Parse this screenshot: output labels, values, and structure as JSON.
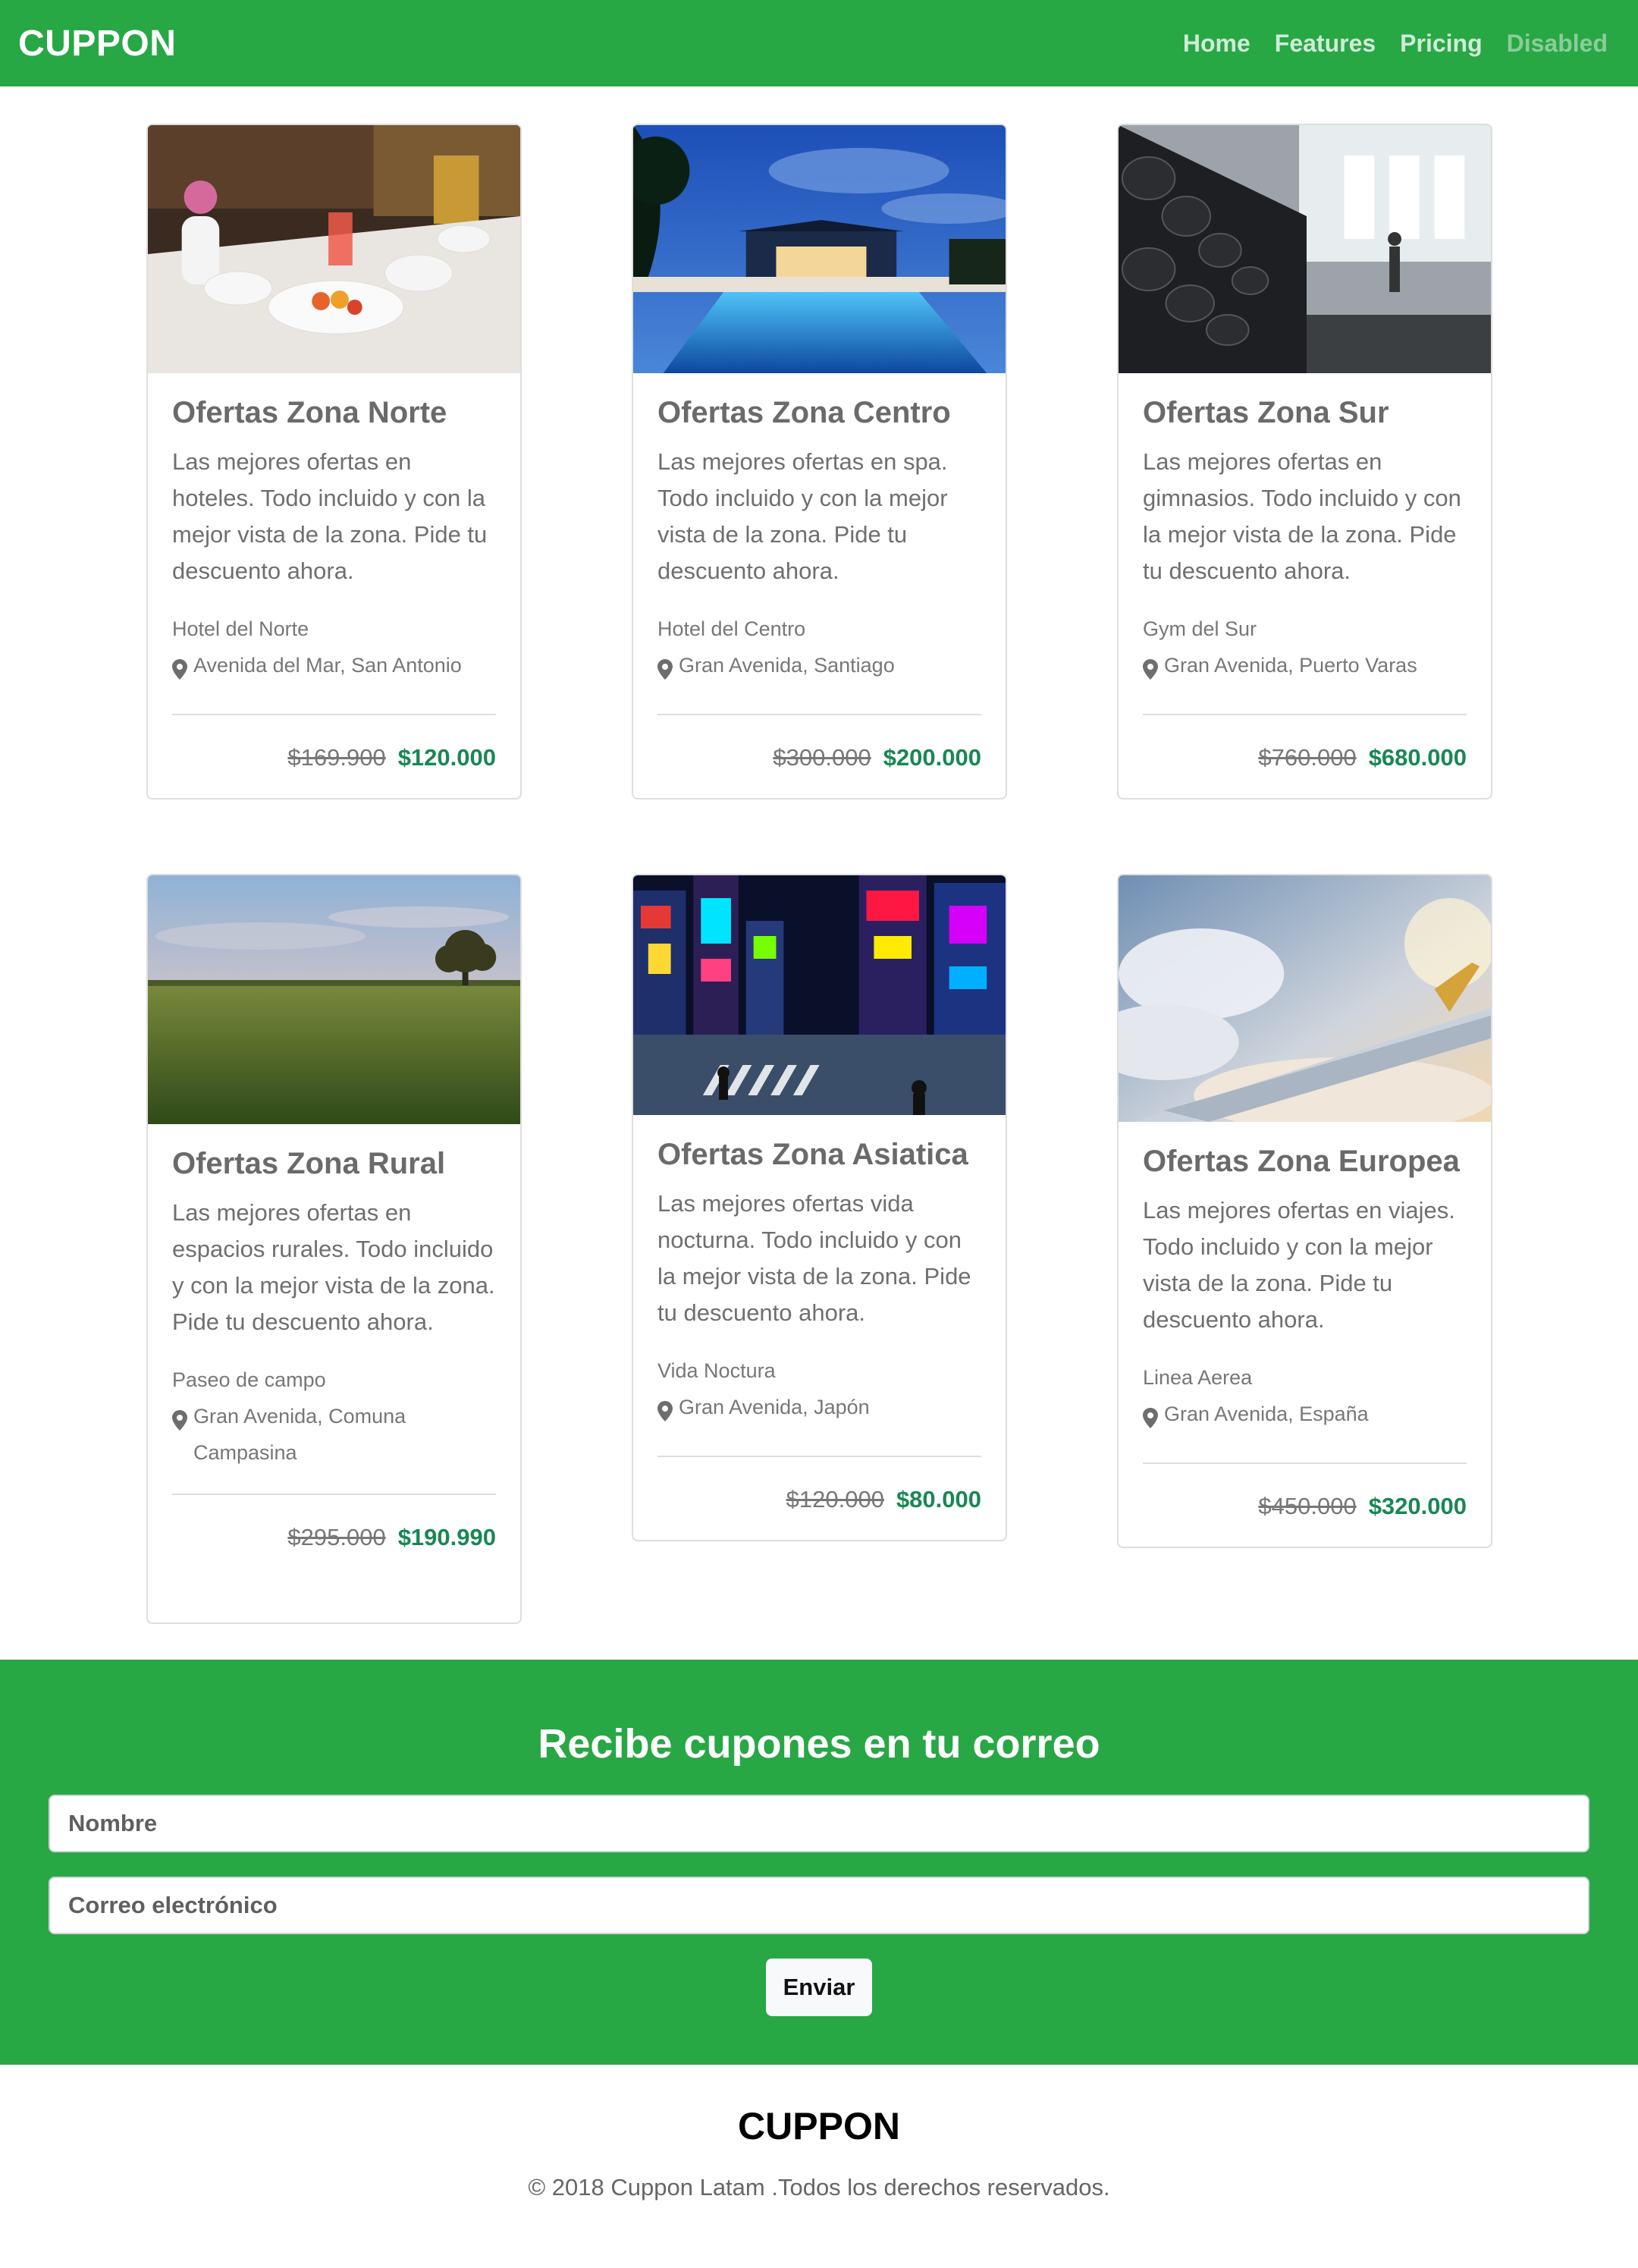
{
  "navbar": {
    "brand": "CUPPON",
    "links": [
      {
        "label": "Home"
      },
      {
        "label": "Features"
      },
      {
        "label": "Pricing"
      },
      {
        "label": "Disabled"
      }
    ]
  },
  "cards": [
    {
      "title": "Ofertas Zona Norte",
      "text": "Las mejores ofertas en hoteles. Todo incluido y con la mejor vista de la zona. Pide tu descuento ahora.",
      "place": "Hotel del Norte",
      "location": "Avenida del Mar, San Antonio",
      "old_price": "$169.900",
      "new_price": "$120.000"
    },
    {
      "title": "Ofertas Zona Centro",
      "text": "Las mejores ofertas en spa. Todo incluido y con la mejor vista de la zona. Pide tu descuento ahora.",
      "place": "Hotel del Centro",
      "location": "Gran Avenida, Santiago",
      "old_price": "$300.000",
      "new_price": "$200.000"
    },
    {
      "title": "Ofertas Zona Sur",
      "text": "Las mejores ofertas en gimnasios. Todo incluido y con la mejor vista de la zona. Pide tu descuento ahora.",
      "place": "Gym del Sur",
      "location": "Gran Avenida, Puerto Varas",
      "old_price": "$760.000",
      "new_price": "$680.000"
    },
    {
      "title": "Ofertas Zona Rural",
      "text": "Las mejores ofertas en espacios rurales. Todo incluido y con la mejor vista de la zona. Pide tu descuento ahora.",
      "place": "Paseo de campo",
      "location": "Gran Avenida, Comuna Campasina",
      "old_price": "$295.000",
      "new_price": "$190.990"
    },
    {
      "title": "Ofertas Zona Asiatica",
      "text": "Las mejores ofertas vida nocturna. Todo incluido y con la mejor vista de la zona. Pide tu descuento ahora.",
      "place": "Vida Noctura",
      "location": "Gran Avenida, Japón",
      "old_price": "$120.000",
      "new_price": "$80.000"
    },
    {
      "title": "Ofertas Zona Europea",
      "text": "Las mejores ofertas en viajes. Todo incluido y con la mejor vista de la zona. Pide tu descuento ahora.",
      "place": "Linea Aerea",
      "location": "Gran Avenida, España",
      "old_price": "$450.000",
      "new_price": "$320.000"
    }
  ],
  "subscribe": {
    "title": "Recibe cupones en tu correo",
    "name_placeholder": "Nombre",
    "email_placeholder": "Correo electrónico",
    "submit_label": "Enviar"
  },
  "footer": {
    "brand": "CUPPON",
    "copyright": "© 2018 Cuppon Latam .Todos los derechos reservados."
  },
  "colors": {
    "brand_green": "#28a745",
    "price_green": "#198754"
  }
}
